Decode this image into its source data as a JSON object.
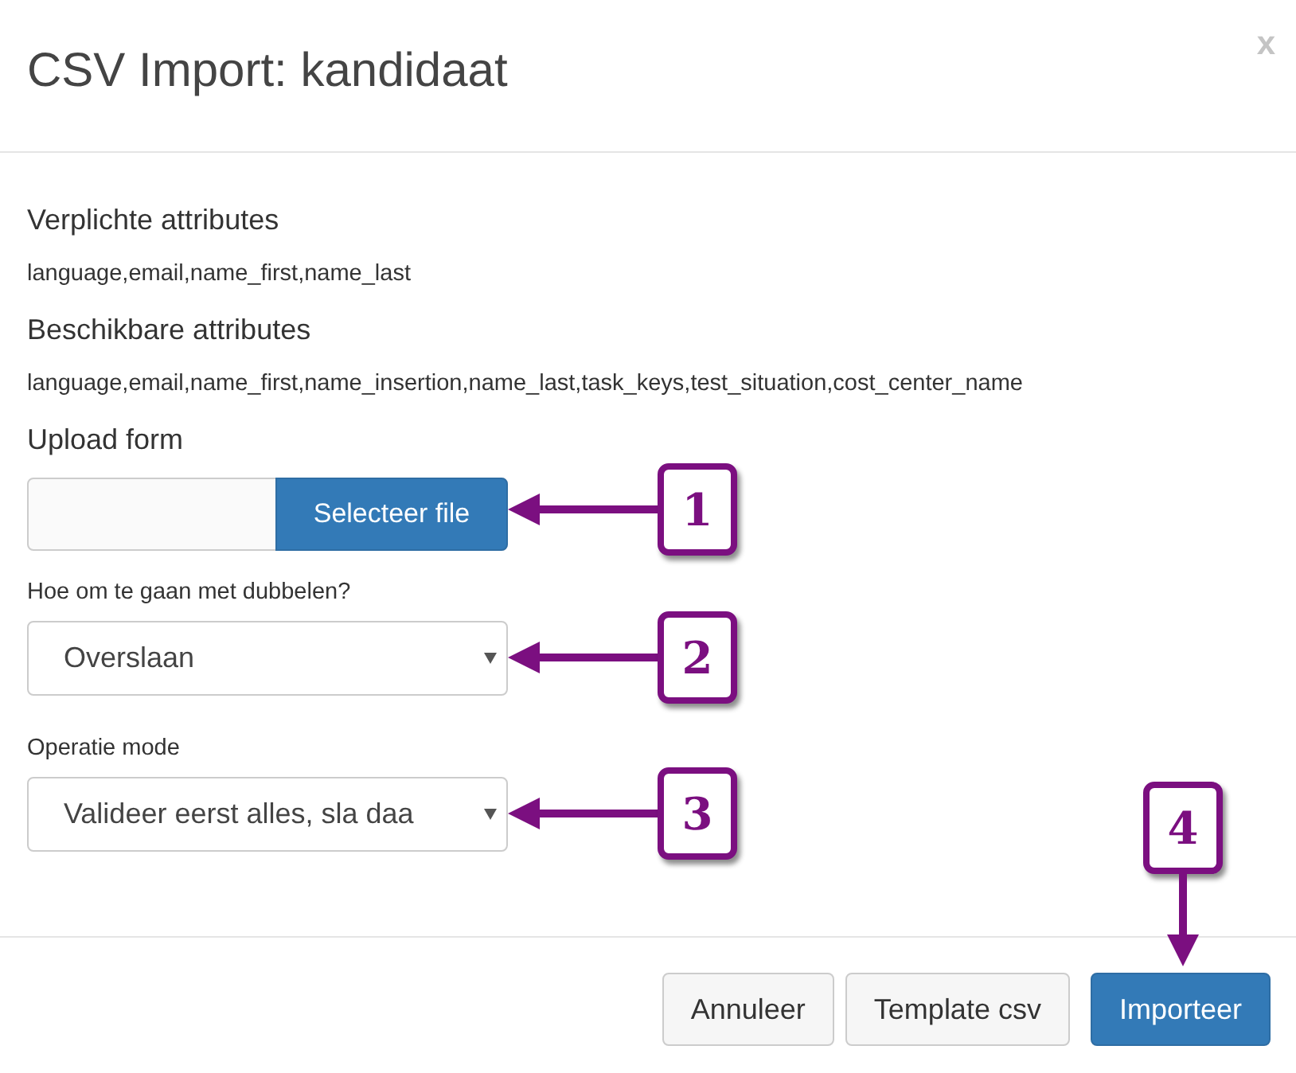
{
  "dialog": {
    "title": "CSV Import: kandidaat",
    "close": "x"
  },
  "sections": [
    {
      "heading": "Verplichte attributes",
      "text": "language,email,name_first,name_last"
    },
    {
      "heading": "Beschikbare attributes",
      "text": "language,email,name_first,name_insertion,name_last,task_keys,test_situation,cost_center_name"
    }
  ],
  "upload": {
    "heading": "Upload form",
    "button": "Selecteer file",
    "callout": "1"
  },
  "fields": [
    {
      "label": "Hoe om te gaan met dubbelen?",
      "value": "Overslaan",
      "callout": "2"
    },
    {
      "label": "Operatie mode",
      "value": "Valideer eerst alles, sla daa",
      "callout": "3"
    }
  ],
  "buttons": [
    {
      "label": "Annuleer",
      "kind": "default"
    },
    {
      "label": "Template csv",
      "kind": "default"
    },
    {
      "label": "Importeer",
      "kind": "primary",
      "callout": "4"
    }
  ]
}
